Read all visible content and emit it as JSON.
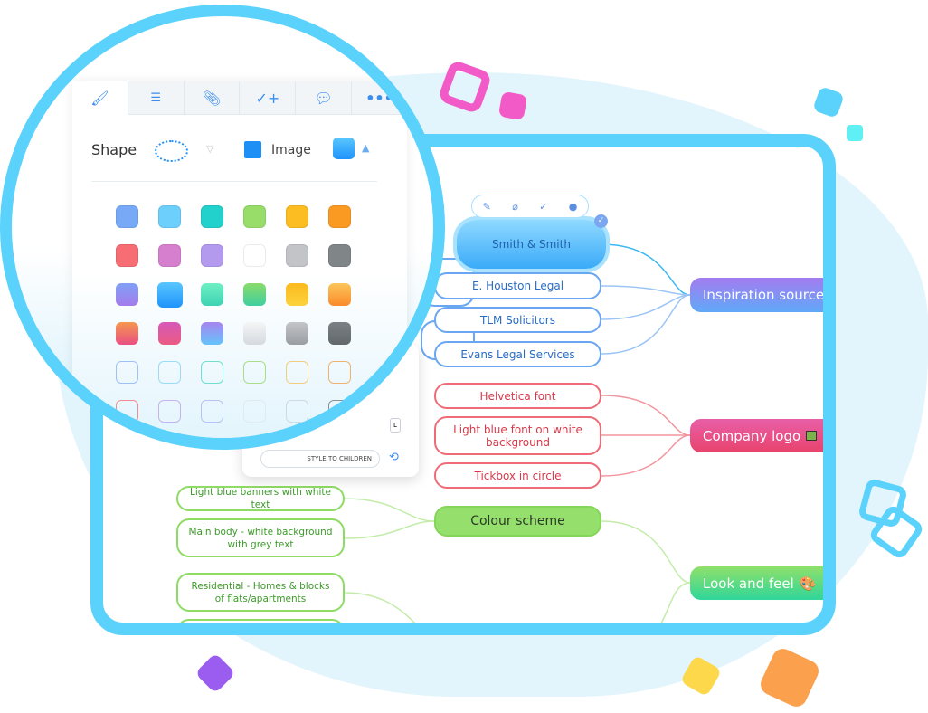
{
  "colors": {
    "accent": "#5ad2fb",
    "blue": "#2a6cc2",
    "red": "#d8394a",
    "green": "#3d9a2a"
  },
  "toolbar_tabs": [
    {
      "icon": "paintbrush-icon",
      "active": true
    },
    {
      "icon": "text-lines-icon"
    },
    {
      "icon": "paperclip-icon"
    },
    {
      "icon": "task-add-icon"
    },
    {
      "icon": "comment-icon"
    },
    {
      "icon": "more-icon"
    }
  ],
  "style_panel": {
    "shape_label": "Shape",
    "image_label": "Image",
    "size_label": "L",
    "apply_children_label": "STYLE TO CHILDREN",
    "swatches": [
      [
        "#78a9f6",
        "#6dcffb",
        "#22d0cc",
        "#98dd6a",
        "#fcbd22",
        "#fb9a23"
      ],
      [
        "#f66d74",
        "#d77fcf",
        "#b49aee",
        "#ffffff",
        "#c2c4c8",
        "#808588"
      ],
      [
        "#7fa0f5|#a47cec",
        "#5ac7ff|#1e93fb",
        "#6ef0c2|#3dd3b4",
        "#8adb6a|#3fcfa0",
        "#fbba1e|#fcd23c",
        "#fbc65a|#fb8a2b"
      ],
      [
        "#f4984f|#ea4f82",
        "#d759b9|#ea5a82",
        "#a784ef|#64c4fb",
        "#f4f5f7|#d5d9de",
        "#c3c5c8|#9a9da1",
        "#7c8185|#62676b"
      ],
      [
        "o:#9cc2f5",
        "o:#9adcf6",
        "o:#6fe0cf",
        "o:#a8df88",
        "o:#f2cd7e",
        "o:#f2b26e"
      ],
      [
        "o:#f28a92",
        "o:#c8b3ef",
        "o:#b7c3f2",
        "o:#dfeaf1",
        "o:#c9dbe6",
        "o:#8b9094"
      ]
    ]
  },
  "node_toolbar": [
    "pencil-icon",
    "paperclip-icon",
    "task-add-icon",
    "comment-icon"
  ],
  "map": {
    "inspiration": {
      "label": "Inspiration sources",
      "children": [
        "Smith & Smith",
        "E. Houston Legal",
        "TLM Solicitors",
        "Evans Legal Services"
      ]
    },
    "company_logo": {
      "label": "Company logo",
      "icon": "image-icon",
      "children": [
        "Helvetica font",
        "Light blue font on white background",
        "Tickbox in circle"
      ]
    },
    "colour_scheme": {
      "label": "Colour scheme",
      "children": [
        "Light blue banners with white text",
        "Main body - white background with grey text"
      ]
    },
    "look_and_feel": {
      "label": "Look and feel",
      "icon": "palette-icon"
    },
    "residential": "Residential - Homes & blocks of flats/apartments"
  }
}
